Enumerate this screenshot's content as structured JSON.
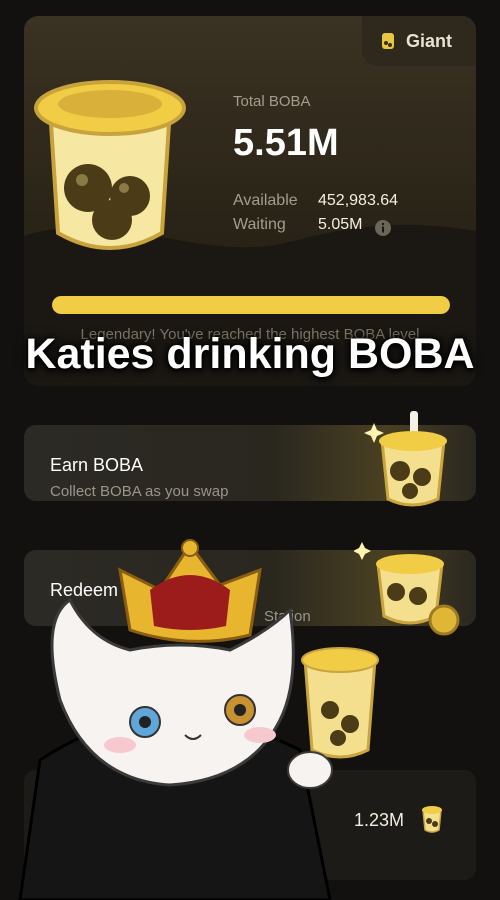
{
  "badge": {
    "label": "Giant",
    "icon": "boba-cup-icon"
  },
  "stats": {
    "total_label": "Total BOBA",
    "total_value": "5.51M",
    "available_label": "Available",
    "available_value": "452,983.64",
    "waiting_label": "Waiting",
    "waiting_value": "5.05M",
    "info_icon": "info-icon"
  },
  "progress": {
    "fraction": 1.0
  },
  "level_message": "Legendary! You've reached the highest BOBA level",
  "overlay_title": "Katies drinking BOBA",
  "cards": [
    {
      "title": "Earn BOBA",
      "subtitle": "Collect BOBA as you swap"
    },
    {
      "title": "Redeem",
      "subtitle": "Station"
    }
  ],
  "bottom": {
    "value": "1.23M",
    "icon": "boba-cup-icon"
  },
  "colors": {
    "accent": "#f1cc45",
    "background": "#121110",
    "card": "#2a271f"
  }
}
